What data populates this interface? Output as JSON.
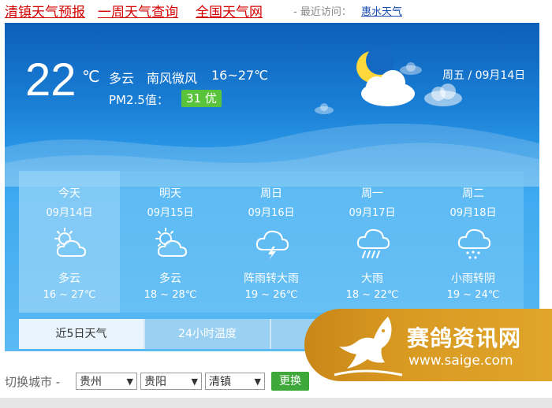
{
  "header": {
    "links": [
      "清镇天气预报",
      "一周天气查询",
      "全国天气网"
    ],
    "recent_label": "- 最近访问：",
    "recent_link": "惠水天气"
  },
  "current": {
    "temp": "22",
    "unit": "℃",
    "condition": "多云",
    "wind": "南风微风",
    "range": "16~27℃",
    "pm_label": "PM2.5值：",
    "pm_value": "31 优",
    "date": "周五 / 09月14日"
  },
  "forecast": [
    {
      "name": "今天",
      "date": "09月14日",
      "icon": "partly-cloudy-icon",
      "cond": "多云",
      "temp": "16 ~ 27℃"
    },
    {
      "name": "明天",
      "date": "09月15日",
      "icon": "partly-cloudy-icon",
      "cond": "多云",
      "temp": "18 ~ 28℃"
    },
    {
      "name": "周日",
      "date": "09月16日",
      "icon": "thunderstorm-icon",
      "cond": "阵雨转大雨",
      "temp": "19 ~ 26℃"
    },
    {
      "name": "周一",
      "date": "09月17日",
      "icon": "heavy-rain-icon",
      "cond": "大雨",
      "temp": "18 ~ 22℃"
    },
    {
      "name": "周二",
      "date": "09月18日",
      "icon": "light-rain-icon",
      "cond": "小雨转阴",
      "temp": "19 ~ 24℃"
    }
  ],
  "tabs": [
    "近5日天气",
    "24小时温度"
  ],
  "city_switch": {
    "label": "切换城市 -",
    "province": "贵州",
    "city": "贵阳",
    "district": "清镇",
    "button": "更换"
  },
  "watermark": {
    "text": "赛鸽资讯网",
    "url": "www.saige.com"
  },
  "colors": {
    "header_link": "#d40000",
    "pm_badge": "#59c43b",
    "button": "#3fa83a",
    "watermark": "#d99a22"
  }
}
